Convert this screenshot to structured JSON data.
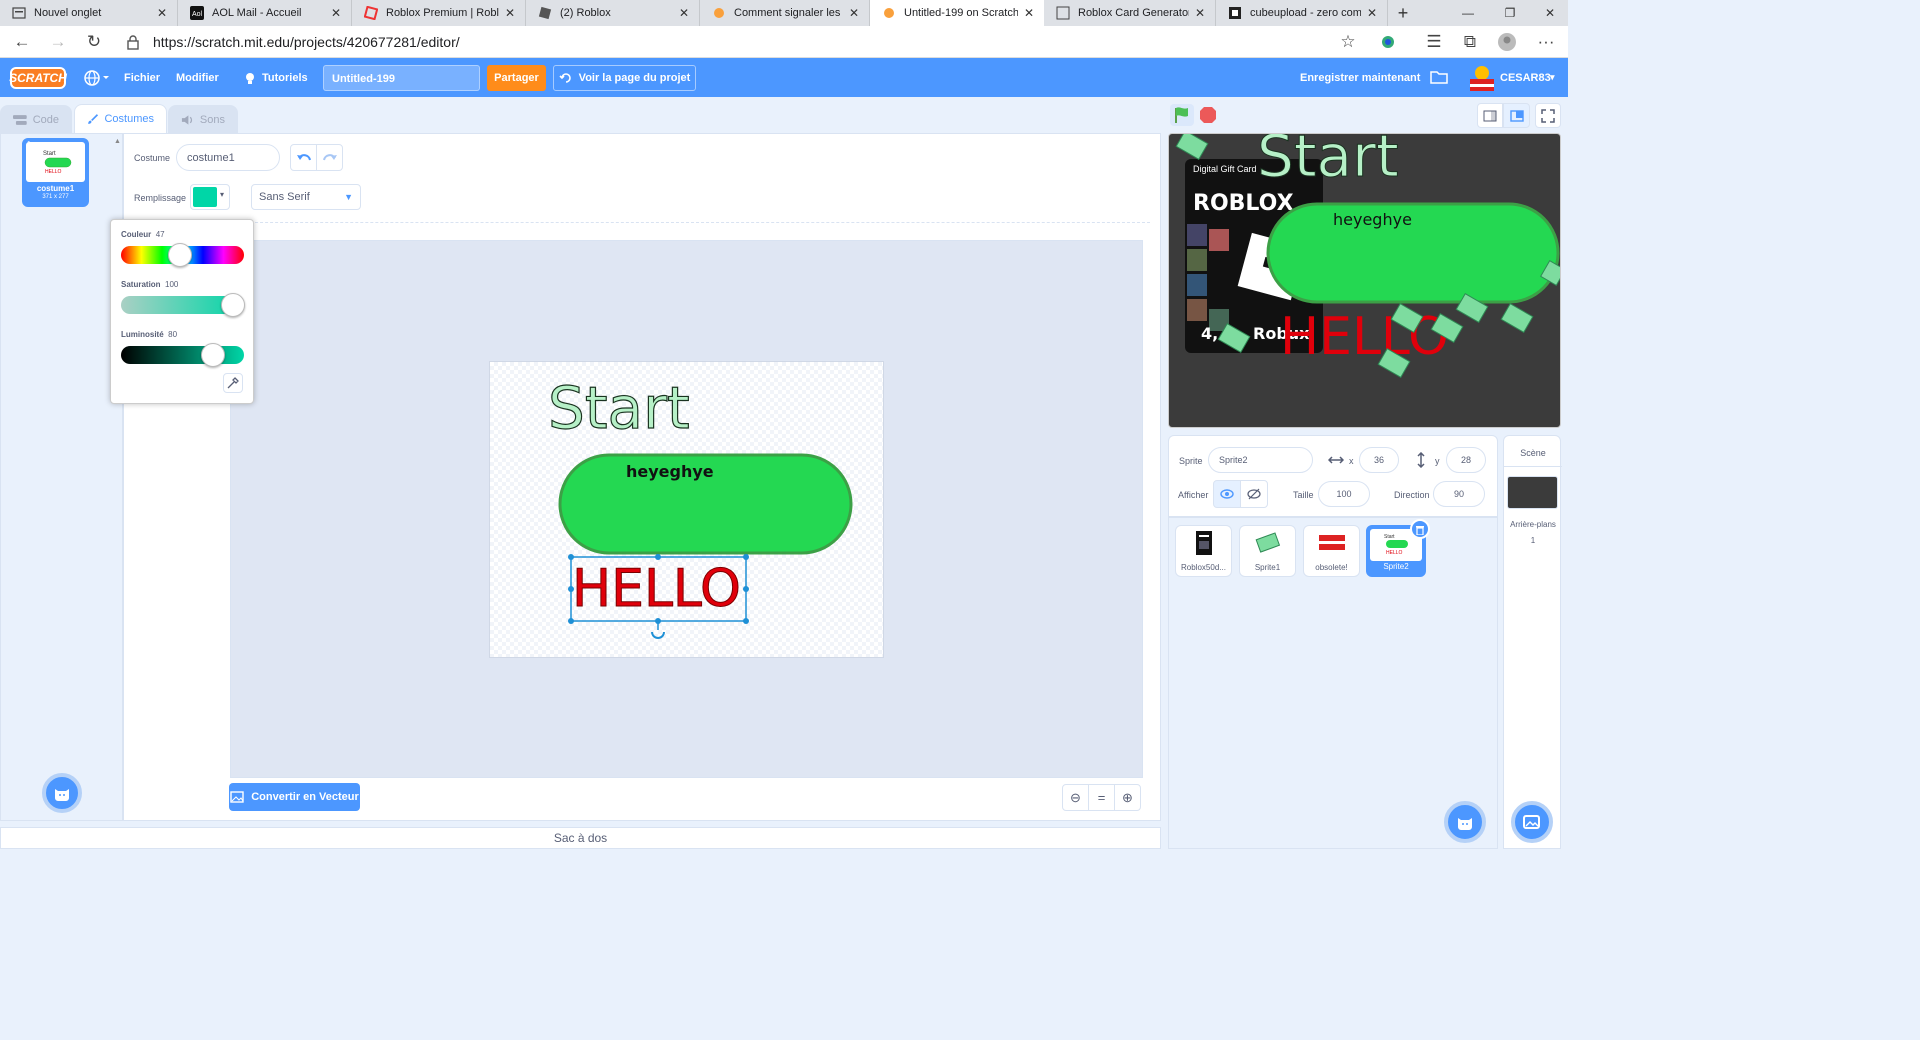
{
  "browser": {
    "tabs": [
      {
        "title": "Nouvel onglet"
      },
      {
        "title": "AOL Mail - Accueil"
      },
      {
        "title": "Roblox Premium | Roblox W"
      },
      {
        "title": "(2) Roblox"
      },
      {
        "title": "Comment signaler les comm"
      },
      {
        "title": "Untitled-199 on Scratch"
      },
      {
        "title": "Roblox Card Generator! - P"
      },
      {
        "title": "cubeupload - zero compres"
      }
    ],
    "url": "https://scratch.mit.edu/projects/420677281/editor/"
  },
  "menubar": {
    "logo": "SCRATCH",
    "file": "Fichier",
    "edit": "Modifier",
    "tutorials": "Tutoriels",
    "project_title": "Untitled-199",
    "share": "Partager",
    "see_project": "Voir la page du projet",
    "save_now": "Enregistrer maintenant",
    "username": "CESAR83"
  },
  "editor_tabs": {
    "code": "Code",
    "costumes": "Costumes",
    "sounds": "Sons"
  },
  "costume_list": [
    {
      "index": "1",
      "name": "costume1",
      "size": "371 x 277"
    }
  ],
  "paint": {
    "costume_label": "Costume",
    "costume_name": "costume1",
    "fill_label": "Remplissage",
    "fill_color": "#00d6a7",
    "font": "Sans Serif",
    "color_popup": {
      "color_label": "Couleur",
      "color_value": "47",
      "saturation_label": "Saturation",
      "saturation_value": "100",
      "brightness_label": "Luminosité",
      "brightness_value": "80"
    },
    "convert_button": "Convertir en Vecteur",
    "canvas_texts": {
      "start": "Start",
      "button": "heyeghye",
      "hello": "HELLO"
    }
  },
  "backpack": "Sac à dos",
  "stage": {
    "texts": {
      "start": "Start",
      "card_top": "Digital Gift Card",
      "roblox": "ROBLOX",
      "robux": "4,",
      "robux2": "Robux",
      "button": "heyeghye",
      "hello": "HELLO"
    }
  },
  "sprite_info": {
    "sprite_label": "Sprite",
    "sprite_name": "Sprite2",
    "x_label": "x",
    "x_value": "36",
    "y_label": "y",
    "y_value": "28",
    "show_label": "Afficher",
    "size_label": "Taille",
    "size_value": "100",
    "direction_label": "Direction",
    "direction_value": "90"
  },
  "sprites": [
    {
      "name": "Roblox50d..."
    },
    {
      "name": "Sprite1"
    },
    {
      "name": "obsolete!"
    },
    {
      "name": "Sprite2"
    }
  ],
  "scene": {
    "title": "Scène",
    "backdrops_label": "Arrière-plans",
    "backdrops_count": "1"
  },
  "colors": {
    "scratch_blue": "#4c97ff",
    "orange": "#ff8c1a",
    "green_button": "#24d852",
    "hello_red": "#e0000b"
  }
}
